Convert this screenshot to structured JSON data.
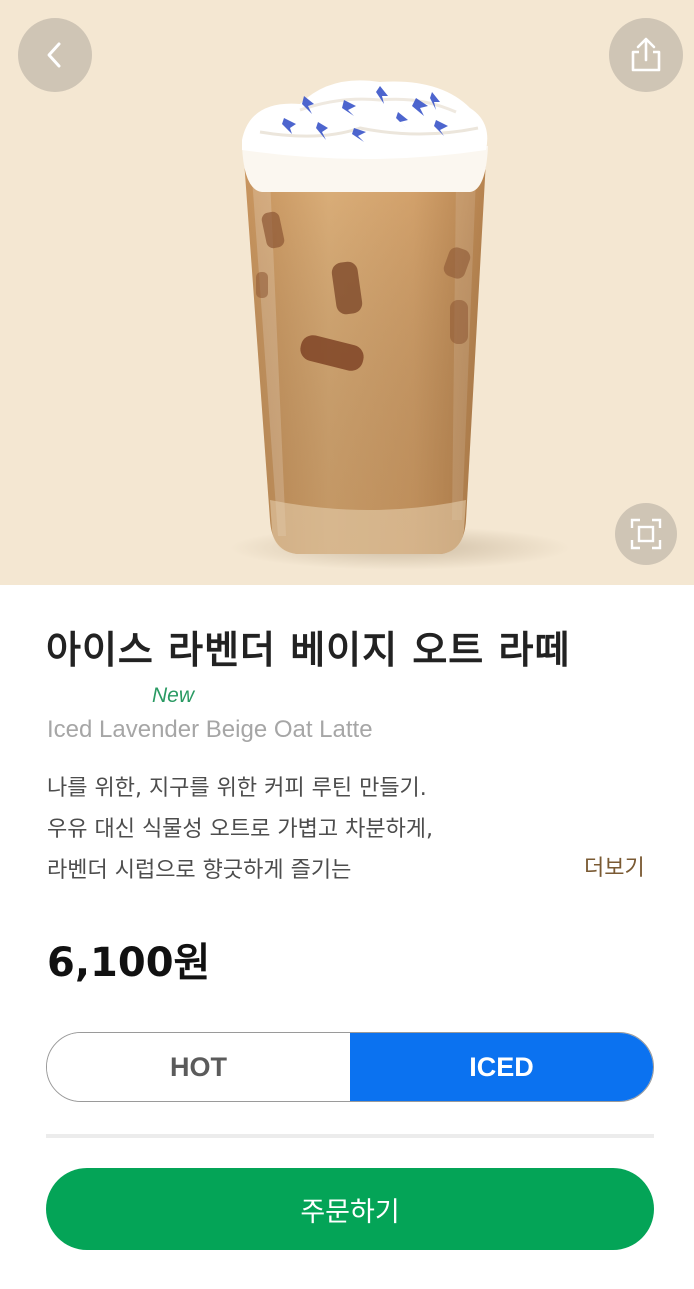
{
  "product": {
    "name_ko": "아이스 라벤더 베이지 오트 라떼",
    "new_badge": "New",
    "name_en": "Iced Lavender Beige Oat Latte",
    "description_lines": [
      "나를 위한, 지구를 위한 커피 루틴 만들기.",
      "우유 대신 식물성 오트로 가볍고 차분하게,",
      "라벤더 시럽으로 향긋하게 즐기는"
    ],
    "more_label": "더보기",
    "price": "6,100원"
  },
  "temperature": {
    "options": [
      "HOT",
      "ICED"
    ],
    "selected": "ICED"
  },
  "actions": {
    "order_label": "주문하기"
  },
  "icons": {
    "back": "chevron-left-icon",
    "share": "share-icon",
    "expand": "expand-icon"
  },
  "colors": {
    "hero_background": "#f4e7d2",
    "accent_green": "#04a457",
    "selected_blue": "#0b72f0",
    "new_badge": "#2a9a63",
    "more_link": "#7a5a33"
  }
}
